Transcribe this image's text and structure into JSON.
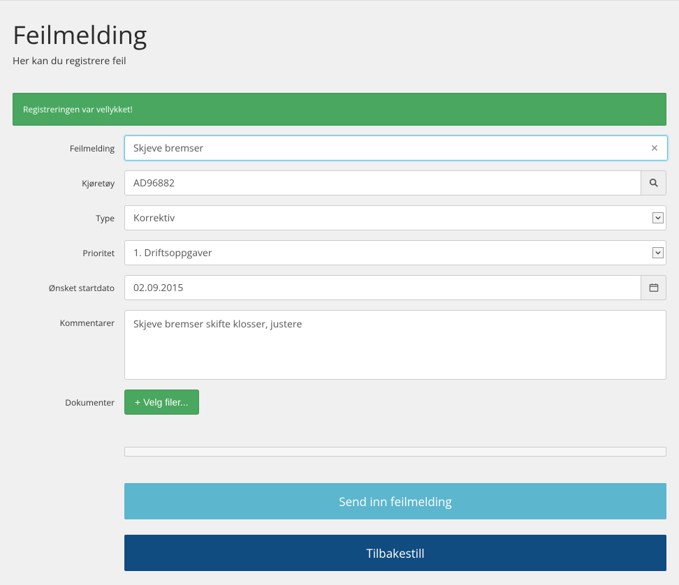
{
  "header": {
    "title": "Feilmelding",
    "subtitle": "Her kan du registrere feil"
  },
  "alert": {
    "success": "Registreringen var vellykket!"
  },
  "form": {
    "feilmelding": {
      "label": "Feilmelding",
      "value": "Skjeve bremser"
    },
    "kjoretoy": {
      "label": "Kjøretøy",
      "value": "AD96882"
    },
    "type": {
      "label": "Type",
      "value": "Korrektiv"
    },
    "prioritet": {
      "label": "Prioritet",
      "value": "1. Driftsoppgaver"
    },
    "startdato": {
      "label": "Ønsket startdato",
      "value": "02.09.2015"
    },
    "kommentarer": {
      "label": "Kommentarer",
      "value": "Skjeve bremser skifte klosser, justere"
    },
    "dokumenter": {
      "label": "Dokumenter",
      "button": "+ Velg filer..."
    }
  },
  "buttons": {
    "submit": "Send inn feilmelding",
    "reset": "Tilbakestill"
  }
}
